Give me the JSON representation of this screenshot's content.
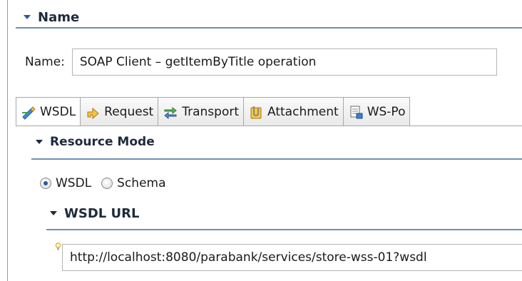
{
  "name_section": {
    "title": "Name"
  },
  "name_field": {
    "label": "Name:",
    "value": "SOAP Client – getItemByTitle operation"
  },
  "tabs": [
    {
      "label": "WSDL",
      "icon": "wsdl-icon",
      "active": true
    },
    {
      "label": "Request",
      "icon": "request-icon",
      "active": false
    },
    {
      "label": "Transport",
      "icon": "transport-icon",
      "active": false
    },
    {
      "label": "Attachment",
      "icon": "attachment-icon",
      "active": false
    },
    {
      "label": "WS-Po",
      "icon": "ws-policy-icon",
      "active": false
    }
  ],
  "resource_mode": {
    "title": "Resource Mode",
    "options": [
      {
        "label": "WSDL",
        "selected": true
      },
      {
        "label": "Schema",
        "selected": false
      }
    ]
  },
  "wsdl_url": {
    "title": "WSDL URL",
    "value": "http://localhost:8080/parabank/services/store-wss-01?wsdl"
  },
  "colors": {
    "section_rule": "#6f8fb6",
    "accent": "#2b5b9a"
  }
}
